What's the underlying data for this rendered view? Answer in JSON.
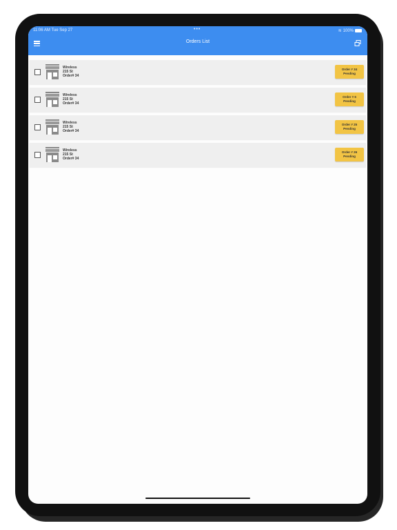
{
  "status_bar": {
    "time": "11:06 AM  Tue Sep 27",
    "dots": "•••",
    "wifi": "≋",
    "battery": "100%"
  },
  "header": {
    "title": "Orders List",
    "menu_icon": "hamburger-menu-icon",
    "action_icon": "copy-icon",
    "color": "#3d8df0"
  },
  "orders": [
    {
      "name": "Wireless",
      "street": "215 St",
      "order_line": "Order# 34",
      "badge_order": "Order # 34",
      "badge_status": "Pending"
    },
    {
      "name": "Wireless",
      "street": "215 St",
      "order_line": "Order# 34",
      "badge_order": "Order # 6",
      "badge_status": "Pending"
    },
    {
      "name": "Wireless",
      "street": "215 St",
      "order_line": "Order# 34",
      "badge_order": "Order # 25",
      "badge_status": "Pending"
    },
    {
      "name": "Wireless",
      "street": "215 St",
      "order_line": "Order# 34",
      "badge_order": "Order # 26",
      "badge_status": "Pending"
    }
  ],
  "badge_color": "#f2c444"
}
